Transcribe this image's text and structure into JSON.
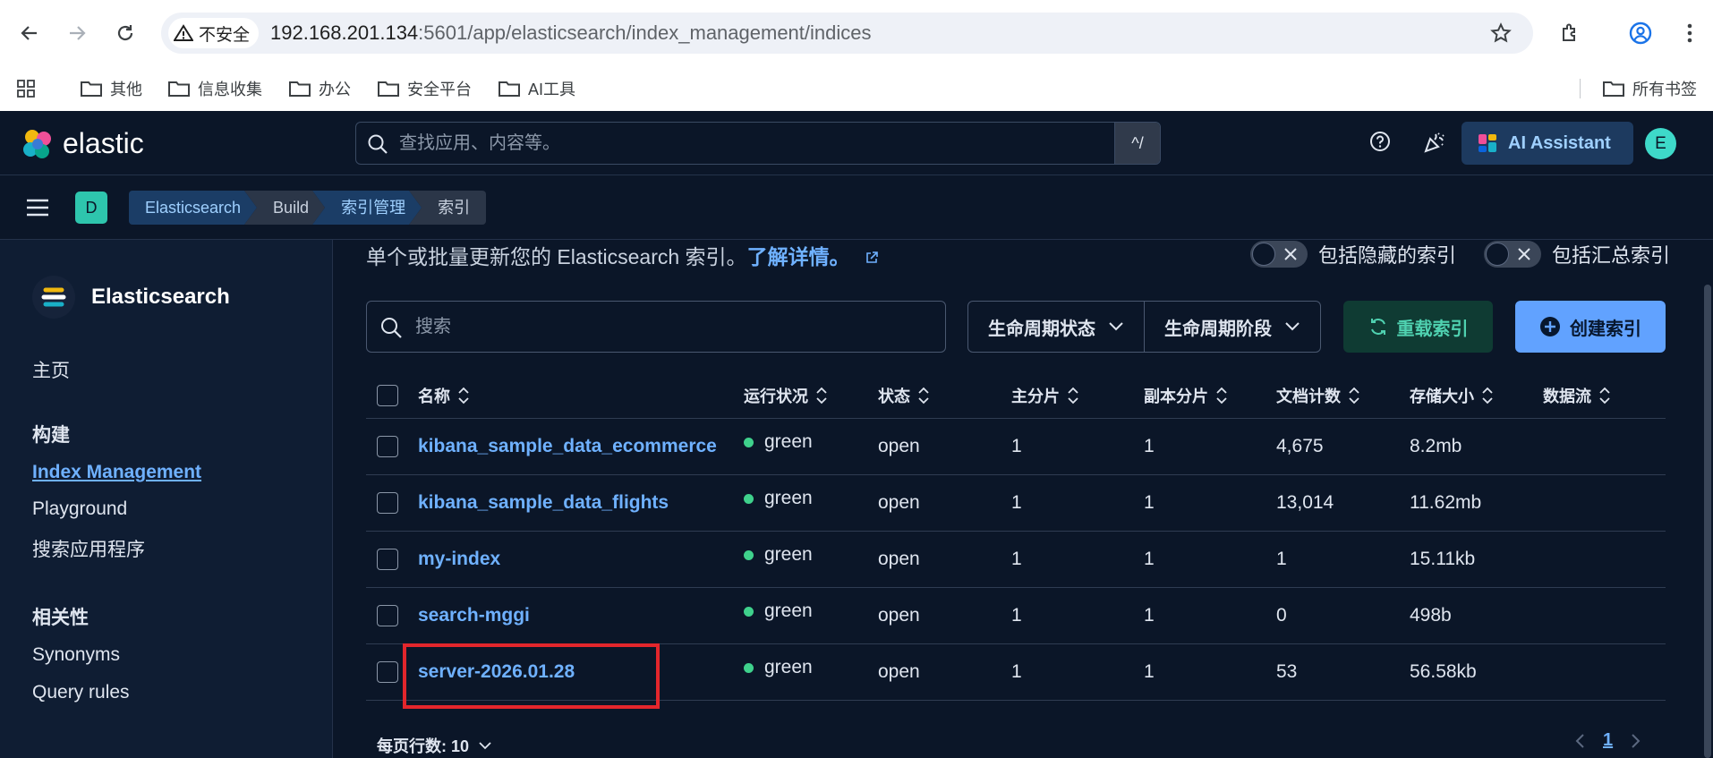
{
  "browser": {
    "security_label": "不安全",
    "url_host": "192.168.201.134",
    "url_rest": ":5601/app/elasticsearch/index_management/indices",
    "bookmarks": [
      "其他",
      "信息收集",
      "办公",
      "安全平台",
      "AI工具"
    ],
    "all_bookmarks": "所有书签"
  },
  "header": {
    "logo_text": "elastic",
    "search_placeholder": "查找应用、内容等。",
    "search_shortcut": "^/",
    "ai_label": "AI Assistant",
    "avatar": "E"
  },
  "subheader": {
    "space": "D",
    "breadcrumbs": [
      "Elasticsearch",
      "Build",
      "索引管理",
      "索引"
    ]
  },
  "sidebar": {
    "title": "Elasticsearch",
    "home": "主页",
    "build_head": "构建",
    "index_management": "Index Management",
    "playground": "Playground",
    "search_apps": "搜索应用程序",
    "relevance_head": "相关性",
    "synonyms": "Synonyms",
    "query_rules": "Query rules"
  },
  "main": {
    "description": "单个或批量更新您的 Elasticsearch 索引。",
    "learn_more": "了解详情。",
    "toggle_hidden": "包括隐藏的索引",
    "toggle_rollup": "包括汇总索引",
    "search_placeholder": "搜索",
    "filter_lifecycle_status": "生命周期状态",
    "filter_lifecycle_phase": "生命周期阶段",
    "reload_label": "重载索引",
    "create_label": "创建索引",
    "columns": [
      "名称",
      "运行状况",
      "状态",
      "主分片",
      "副本分片",
      "文档计数",
      "存储大小",
      "数据流"
    ],
    "rows": [
      {
        "name": "kibana_sample_data_ecommerce",
        "health": "green",
        "status": "open",
        "primary": "1",
        "replicas": "1",
        "docs": "4,675",
        "size": "8.2mb",
        "stream": ""
      },
      {
        "name": "kibana_sample_data_flights",
        "health": "green",
        "status": "open",
        "primary": "1",
        "replicas": "1",
        "docs": "13,014",
        "size": "11.62mb",
        "stream": ""
      },
      {
        "name": "my-index",
        "health": "green",
        "status": "open",
        "primary": "1",
        "replicas": "1",
        "docs": "1",
        "size": "15.11kb",
        "stream": ""
      },
      {
        "name": "search-mggi",
        "health": "green",
        "status": "open",
        "primary": "1",
        "replicas": "1",
        "docs": "0",
        "size": "498b",
        "stream": ""
      },
      {
        "name": "server-2026.01.28",
        "health": "green",
        "status": "open",
        "primary": "1",
        "replicas": "1",
        "docs": "53",
        "size": "56.58kb",
        "stream": ""
      }
    ],
    "rows_per_page": "每页行数: 10",
    "current_page": "1"
  }
}
